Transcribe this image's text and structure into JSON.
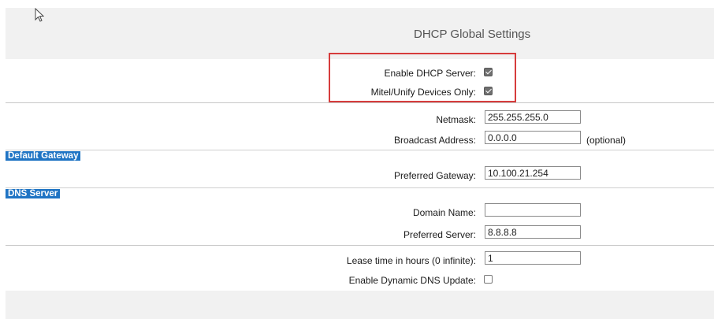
{
  "page_title": "DHCP Global Settings",
  "sections": {
    "default_gateway": "Default Gateway",
    "dns_server": "DNS Server"
  },
  "fields": {
    "enable_dhcp_server": {
      "label": "Enable DHCP Server:",
      "checked": true
    },
    "mitel_unify_only": {
      "label": "Mitel/Unify Devices Only:",
      "checked": true
    },
    "netmask": {
      "label": "Netmask:",
      "value": "255.255.255.0"
    },
    "broadcast_address": {
      "label": "Broadcast Address:",
      "value": "0.0.0.0",
      "hint": "(optional)"
    },
    "preferred_gateway": {
      "label": "Preferred Gateway:",
      "value": "10.100.21.254"
    },
    "domain_name": {
      "label": "Domain Name:",
      "value": ""
    },
    "preferred_server": {
      "label": "Preferred Server:",
      "value": "8.8.8.8"
    },
    "lease_time": {
      "label": "Lease time in hours (0 infinite):",
      "value": "1"
    },
    "dynamic_dns_update": {
      "label": "Enable Dynamic DNS Update:",
      "checked": false
    }
  },
  "colors": {
    "section_label_bg": "#1f74c4",
    "highlight_box": "#d63c3c",
    "band_bg": "#f1f1f1"
  },
  "icons": {
    "cursor": "mouse-pointer-icon"
  }
}
